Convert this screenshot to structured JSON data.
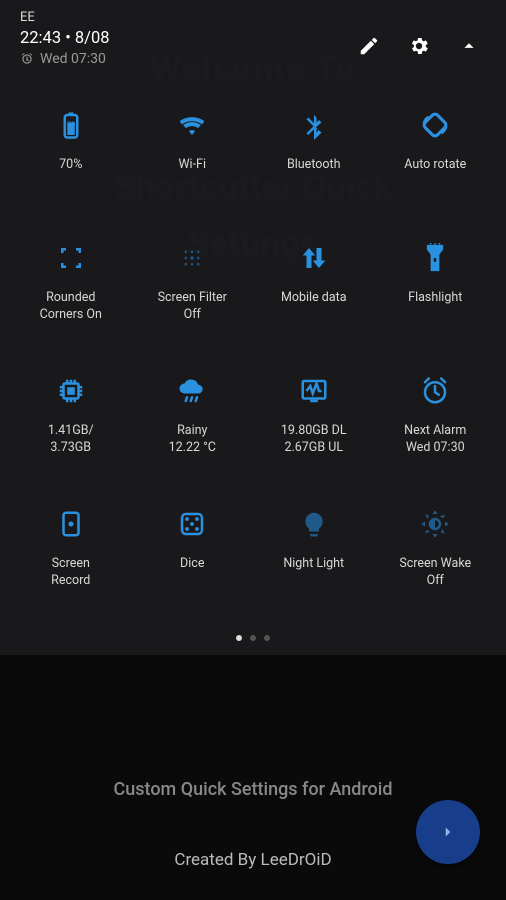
{
  "status_bar": {
    "carrier": "EE"
  },
  "header": {
    "time": "22:43",
    "separator": "•",
    "date": "8/08",
    "alarm_text": "Wed 07:30"
  },
  "tiles": [
    {
      "id": "battery",
      "label": "70%",
      "battery_pct": "70"
    },
    {
      "id": "wifi",
      "label": "Wi-Fi"
    },
    {
      "id": "bluetooth",
      "label": "Bluetooth"
    },
    {
      "id": "auto-rotate",
      "label": "Auto rotate"
    },
    {
      "id": "rounded-corners",
      "label": "Rounded\nCorners On"
    },
    {
      "id": "screen-filter",
      "label": "Screen Filter\nOff"
    },
    {
      "id": "mobile-data",
      "label": "Mobile data"
    },
    {
      "id": "flashlight",
      "label": "Flashlight"
    },
    {
      "id": "memory",
      "label": "1.41GB/\n3.73GB"
    },
    {
      "id": "weather",
      "label": "Rainy\n12.22 °C"
    },
    {
      "id": "data-usage",
      "label": "19.80GB DL\n2.67GB UL"
    },
    {
      "id": "next-alarm",
      "label": "Next Alarm\nWed 07:30"
    },
    {
      "id": "screen-record",
      "label": "Screen\nRecord"
    },
    {
      "id": "dice",
      "label": "Dice"
    },
    {
      "id": "night-light",
      "label": "Night Light"
    },
    {
      "id": "screen-wake",
      "label": "Screen Wake\nOff"
    }
  ],
  "page_indicator": {
    "total": 3,
    "current": 0
  },
  "background": {
    "welcome": "Welcome To",
    "title_line1": "Shortcutter Quick",
    "title_line2": "Settings",
    "subtitle": "Custom Quick Settings for Android",
    "author": "Created By LeeDrOiD"
  },
  "colors": {
    "accent": "#2a91e0"
  }
}
